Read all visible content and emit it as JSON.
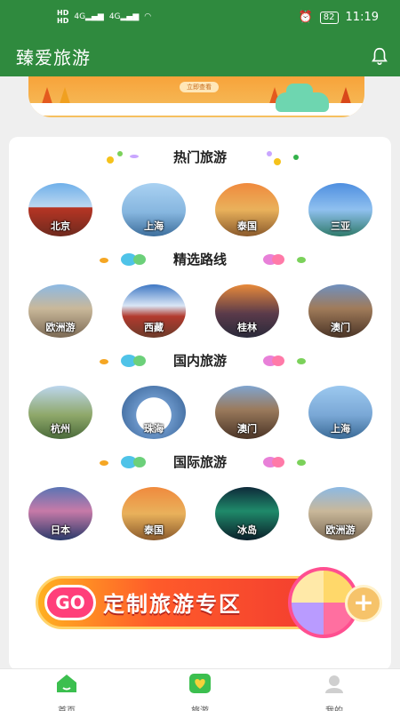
{
  "status_bar": {
    "network_top": "HD",
    "network_bottom": "HD",
    "signal1": "4G",
    "signal2": "4G",
    "battery": "82",
    "time": "11:19"
  },
  "app_bar": {
    "title": "臻爱旅游"
  },
  "top_banner": {
    "tag": "立即查看"
  },
  "sections": [
    {
      "title": "热门旅游",
      "items": [
        "北京",
        "上海",
        "泰国",
        "三亚"
      ]
    },
    {
      "title": "精选路线",
      "items": [
        "欧洲游",
        "西藏",
        "桂林",
        "澳门"
      ]
    },
    {
      "title": "国内旅游",
      "items": [
        "杭州",
        "珠海",
        "澳门",
        "上海"
      ]
    },
    {
      "title": "国际旅游",
      "items": [
        "日本",
        "泰国",
        "冰岛",
        "欧洲游"
      ]
    }
  ],
  "promo": {
    "go": "GO",
    "text": "定制旅游专区",
    "plus": "+"
  },
  "tabs": [
    {
      "label": "首页"
    },
    {
      "label": "旅游"
    },
    {
      "label": "我的"
    }
  ],
  "colors": {
    "brand_green": "#2f8a3e",
    "active_tab": "#3cbf4f"
  }
}
